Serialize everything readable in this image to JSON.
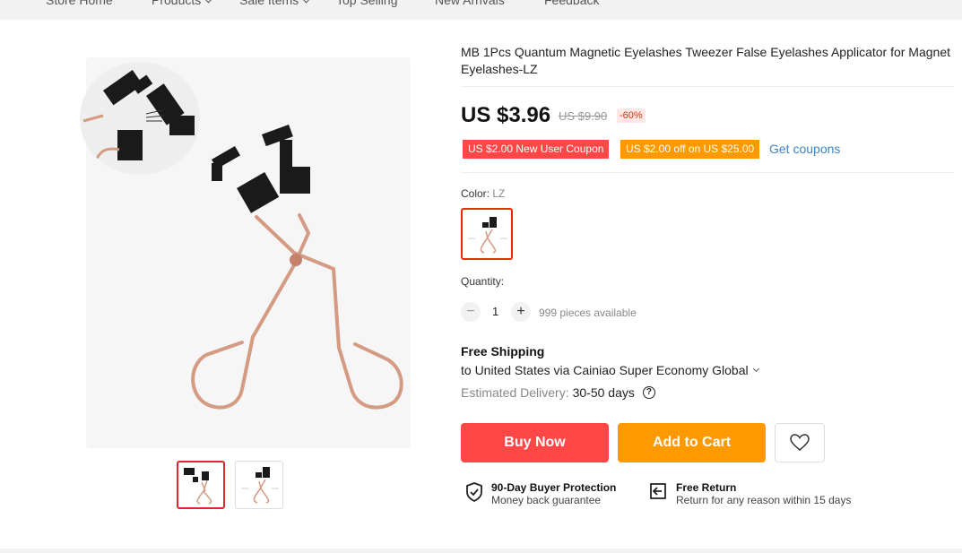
{
  "nav": {
    "items": [
      {
        "label": "Store Home",
        "dropdown": false
      },
      {
        "label": "Products",
        "dropdown": true
      },
      {
        "label": "Sale Items",
        "dropdown": true
      },
      {
        "label": "Top Selling",
        "dropdown": false
      },
      {
        "label": "New Arrivals",
        "dropdown": false
      },
      {
        "label": "Feedback",
        "dropdown": false
      }
    ]
  },
  "product": {
    "title": "MB 1Pcs Quantum Magnetic Eyelashes Tweezer False Eyelashes Applicator for Magnet Eyelashes-LZ",
    "price": "US $3.96",
    "original_price": "US $9.90",
    "discount": "-60%"
  },
  "coupons": {
    "new_user": "US $2.00 New User Coupon",
    "off": "US $2.00 off on US $25.00",
    "get_link": "Get coupons"
  },
  "color": {
    "label": "Color:",
    "value": "LZ"
  },
  "quantity": {
    "label": "Quantity:",
    "minus": "−",
    "plus": "+",
    "value": "1",
    "available": "999 pieces available"
  },
  "shipping": {
    "title": "Free Shipping",
    "to": "to United States via Cainiao Super Economy Global",
    "delivery_label": "Estimated Delivery:",
    "delivery_days": "30-50 days",
    "help": "?"
  },
  "actions": {
    "buy_now": "Buy Now",
    "add_to_cart": "Add to Cart"
  },
  "assurances": {
    "protection_title": "90-Day Buyer Protection",
    "protection_sub": "Money back guarantee",
    "return_title": "Free Return",
    "return_sub": "Return for any reason within 15 days"
  },
  "colors": {
    "accent_red": "#ff4747",
    "accent_orange": "#ff9900",
    "link_blue": "#3a85c9",
    "rose_gold": "#d99a82"
  }
}
